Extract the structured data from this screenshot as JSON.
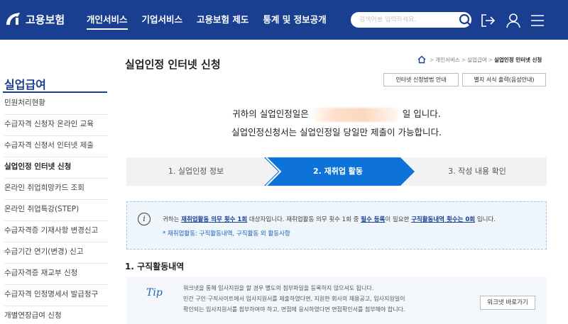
{
  "header": {
    "logo_text": "고용보험",
    "nav": [
      "개인서비스",
      "기업서비스",
      "고용보험 제도",
      "통계 및 정보공개"
    ],
    "search_placeholder": "검색어를 입력하세요.",
    "icons": [
      "search-icon",
      "logout-icon",
      "user-icon",
      "menu-icon"
    ]
  },
  "sidebar": {
    "title": "실업급여",
    "items": [
      "민원처리현황",
      "수급자격 신청자 온라인 교육",
      "수급자격 신청서 인터넷 제출",
      "실업인정 인터넷 신청",
      "온라인 취업희망카드 조회",
      "온라인 취업특강(STEP)",
      "수급자격증 기재사항 변경신고",
      "수급기간 연기(변경) 신고",
      "수급자격증 재교부 신청",
      "수급자격 인정명세서 발급청구",
      "개별연장급여 신청"
    ],
    "active_index": 3
  },
  "main": {
    "title": "실업인정 인터넷 신청",
    "breadcrumb": [
      "개인서비스",
      "실업급여",
      "실업인정 인터넷 신청"
    ],
    "buttons": [
      "인터넷 신청방법 안내",
      "별지 서식 출력(음성안내)"
    ],
    "message_prefix": "귀하의 실업인정일은",
    "message_suffix": "일 입니다.",
    "message_line2": "실업인정신청서는 실업인정일 당일만 제출이 가능합니다.",
    "steps": [
      "1. 실업인정 정보",
      "2. 재취업 활동",
      "3. 작성 내용 확인"
    ],
    "active_step": 1,
    "info": {
      "t1": "귀하는 ",
      "u1": "재취업활동 의무 횟수 1회",
      "t2": " 대상자입니다. 재취업활동 의무 횟수 1회 중 ",
      "u2": "필수 등록",
      "t3": "이 필요한 ",
      "u3": "구직활동내역 횟수는 0회",
      "t4": " 입니다.",
      "note": "* 재취업활동: 구직활동내역, 구직활동 외 활동사항"
    },
    "section1_title": "1. 구직활동내역",
    "tip": {
      "label": "Tip",
      "lines": [
        "워크넷을 통해 입사지원을 할 경우 별도의 첨부파일을 등록하지 않으셔도 됩니다.",
        "민간 구인·구직사이트에서 입사지원서를 제출하였다면, 지원한 회사의 채용공고, 입사지원일이",
        "확인되는 입사지원서를 첨부하여야 하고, 면접에 응시하였다면 면접확인서를 첨부해야 합니다."
      ],
      "button": "워크넷 바로가기"
    }
  },
  "colors": {
    "brand": "#1a3f91",
    "step_active": "#0e73d8"
  }
}
